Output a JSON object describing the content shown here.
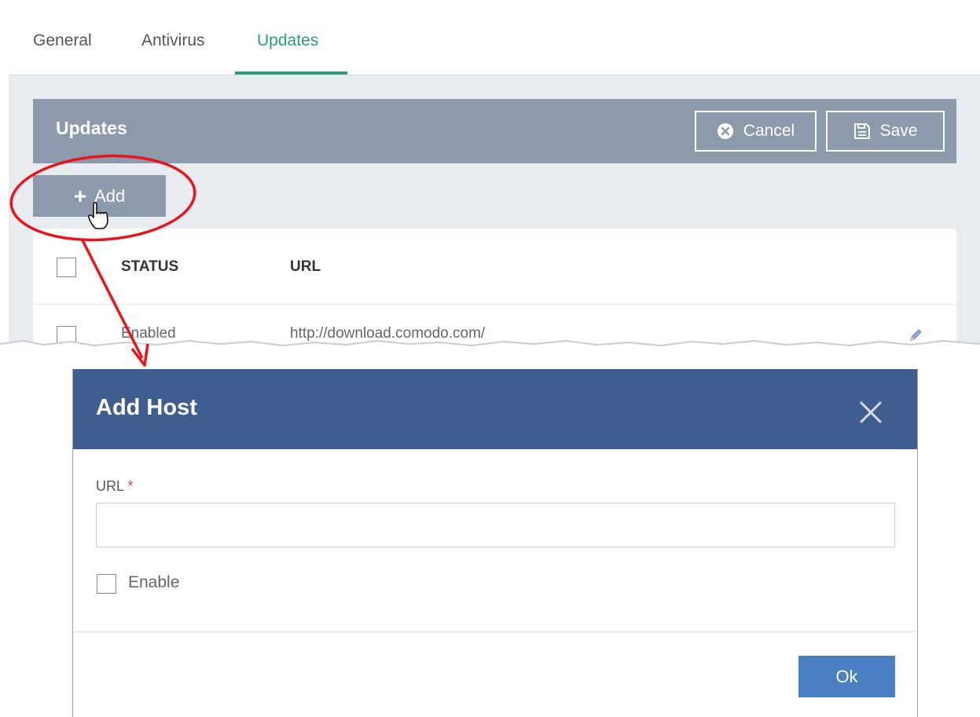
{
  "tabs": [
    {
      "label": "General"
    },
    {
      "label": "Antivirus"
    },
    {
      "label": "Updates",
      "active": true
    }
  ],
  "section": {
    "title": "Updates",
    "cancel_label": "Cancel",
    "save_label": "Save"
  },
  "toolbar": {
    "add_label": "Add"
  },
  "table": {
    "columns": [
      "STATUS",
      "URL"
    ],
    "rows": [
      {
        "status": "Enabled",
        "url": "http://download.comodo.com/"
      }
    ]
  },
  "modal": {
    "title": "Add Host",
    "url_label": "URL",
    "required_marker": "*",
    "url_value": "",
    "enable_label": "Enable",
    "ok_label": "Ok"
  },
  "colors": {
    "accent_tab": "#2a9d7d",
    "header_bar": "#8c9aab",
    "modal_header": "#3f5d8f",
    "ok_button": "#4a7fc4",
    "annotation": "#e8141b"
  },
  "icons": [
    "cancel-circle-x-icon",
    "save-floppy-icon",
    "plus-icon",
    "hand-pointer-icon",
    "pencil-icon",
    "close-x-icon"
  ]
}
